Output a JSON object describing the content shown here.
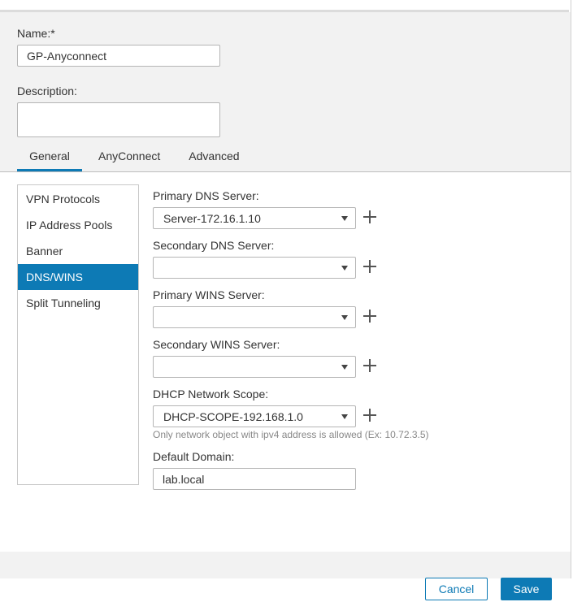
{
  "form": {
    "name_label": "Name:*",
    "name_value": "GP-Anyconnect",
    "description_label": "Description:",
    "description_value": ""
  },
  "tabs": [
    {
      "label": "General",
      "active": true
    },
    {
      "label": "AnyConnect",
      "active": false
    },
    {
      "label": "Advanced",
      "active": false
    }
  ],
  "side_nav": {
    "items": [
      {
        "label": "VPN Protocols",
        "active": false
      },
      {
        "label": "IP Address Pools",
        "active": false
      },
      {
        "label": "Banner",
        "active": false
      },
      {
        "label": "DNS/WINS",
        "active": true
      },
      {
        "label": "Split Tunneling",
        "active": false
      }
    ]
  },
  "dns_wins": {
    "primary_dns_label": "Primary DNS Server:",
    "primary_dns_value": "Server-172.16.1.10",
    "secondary_dns_label": "Secondary DNS Server:",
    "secondary_dns_value": "",
    "primary_wins_label": "Primary WINS Server:",
    "primary_wins_value": "",
    "secondary_wins_label": "Secondary WINS Server:",
    "secondary_wins_value": "",
    "dhcp_label": "DHCP Network Scope:",
    "dhcp_value": "DHCP-SCOPE-192.168.1.0",
    "dhcp_help": "Only network object with ipv4 address is allowed (Ex: 10.72.3.5)",
    "domain_label": "Default Domain:",
    "domain_value": "lab.local"
  },
  "footer": {
    "cancel_label": "Cancel",
    "save_label": "Save"
  },
  "colors": {
    "accent": "#0d7ab5",
    "panel_bg": "#f2f2f2"
  }
}
